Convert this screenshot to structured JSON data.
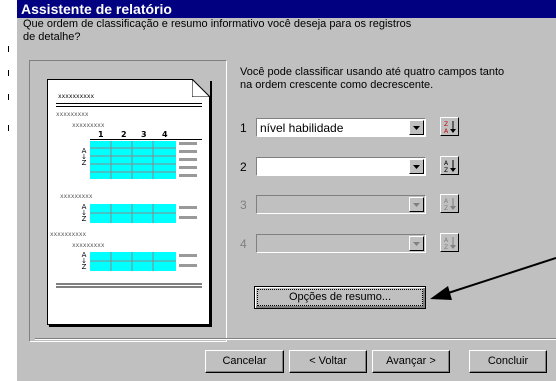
{
  "window": {
    "title": "Assistente de relatório"
  },
  "prompt": {
    "line1": "Que ordem de classificação e resumo informativo você deseja para os registros",
    "line2": "de detalhe?"
  },
  "description": {
    "line1": "Você pode classificar usando até quatro campos tanto",
    "line2": "na ordem crescente como decrescente."
  },
  "preview": {
    "placeholder_long": "xxxxxxxxxx",
    "placeholder_mid": "xxxxxxxxx",
    "placeholder_small": "xxxx",
    "columns": [
      "1",
      "2",
      "3",
      "4"
    ],
    "az_top": "A",
    "az_bottom": "Z"
  },
  "sort_fields": [
    {
      "number": "1",
      "value": "nível habilidade",
      "enabled": true,
      "sort_icon": "sort-descending-icon"
    },
    {
      "number": "2",
      "value": "",
      "enabled": true,
      "sort_icon": "sort-ascending-icon"
    },
    {
      "number": "3",
      "value": "",
      "enabled": false,
      "sort_icon": "sort-ascending-icon"
    },
    {
      "number": "4",
      "value": "",
      "enabled": false,
      "sort_icon": "sort-ascending-icon"
    }
  ],
  "summary_button": {
    "label": "Opções de resumo..."
  },
  "footer": {
    "cancel": "Cancelar",
    "back": "< Voltar",
    "next": "Avançar >",
    "finish": "Concluir"
  },
  "colors": {
    "title_bar": "#000080",
    "dialog": "#c0c0c0",
    "preview_highlight": "#00ffff"
  }
}
